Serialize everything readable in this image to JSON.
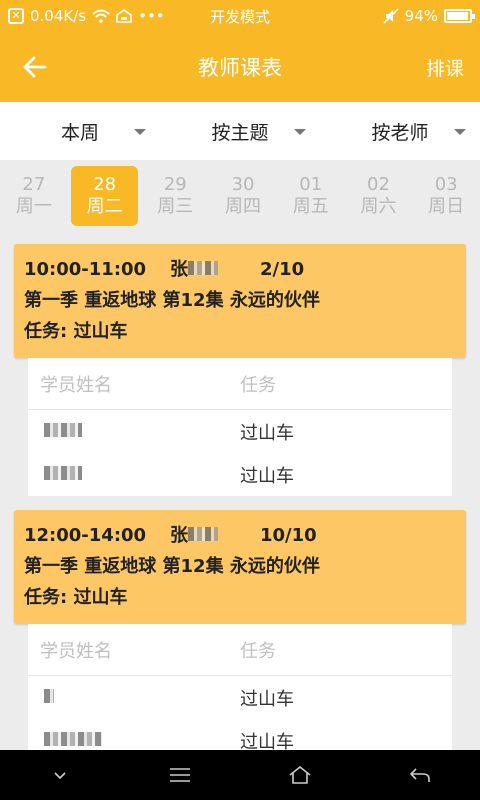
{
  "status_bar": {
    "speed": "0.04K/s",
    "dots": "•••",
    "mode": "开发模式",
    "battery": "94%",
    "battery_level": 0.94
  },
  "app_bar": {
    "title": "教师课表",
    "action": "排课",
    "back_icon": "arrow-left-icon"
  },
  "filters": [
    {
      "label": "本周"
    },
    {
      "label": "按主题"
    },
    {
      "label": "按老师"
    }
  ],
  "days": [
    {
      "date": "27",
      "weekday": "周一",
      "selected": false
    },
    {
      "date": "28",
      "weekday": "周二",
      "selected": true
    },
    {
      "date": "29",
      "weekday": "周三",
      "selected": false
    },
    {
      "date": "30",
      "weekday": "周四",
      "selected": false
    },
    {
      "date": "01",
      "weekday": "周五",
      "selected": false
    },
    {
      "date": "02",
      "weekday": "周六",
      "selected": false
    },
    {
      "date": "03",
      "weekday": "周日",
      "selected": false
    }
  ],
  "lessons": [
    {
      "time": "10:00-11:00",
      "teacher": "张",
      "count": "2/10",
      "title": "第一季 重返地球  第12集 永远的伙伴",
      "task": "任务:  过山车",
      "table_header": {
        "name": "学员姓名",
        "task": "任务"
      },
      "students": [
        {
          "task": "过山车"
        },
        {
          "task": "过山车"
        }
      ]
    },
    {
      "time": "12:00-14:00",
      "teacher": "张",
      "count": "10/10",
      "title": "第一季 重返地球  第12集 永远的伙伴",
      "task": "任务:  过山车",
      "table_header": {
        "name": "学员姓名",
        "task": "任务"
      },
      "students": [
        {
          "task": "过山车"
        },
        {
          "task": "过山车"
        }
      ]
    }
  ],
  "nav": [
    "chevron-down-icon",
    "menu-icon",
    "home-icon",
    "back-icon"
  ],
  "colors": {
    "accent": "#f9b826",
    "card": "#fec765"
  }
}
